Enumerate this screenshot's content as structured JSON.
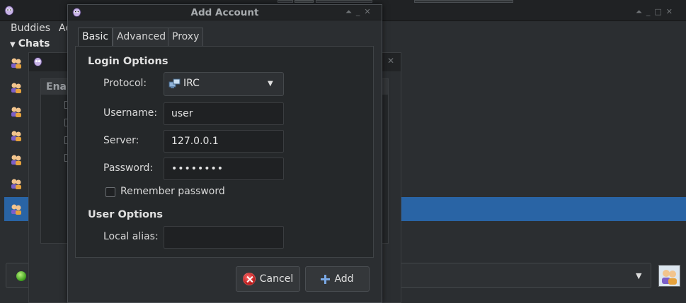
{
  "buddy_window": {
    "menu": [
      "Buddies",
      "Ac"
    ],
    "chats_header": "Chats"
  },
  "accounts_window": {
    "column_header": "Enal"
  },
  "dialog": {
    "title": "Add Account",
    "tabs": [
      {
        "label": "Basic",
        "active": true
      },
      {
        "label": "Advanced",
        "active": false
      },
      {
        "label": "Proxy",
        "active": false
      }
    ],
    "login_options": {
      "title": "Login Options",
      "protocol_label": "Protocol:",
      "protocol_value": "IRC",
      "username_label": "Username:",
      "username_value": "user",
      "server_label": "Server:",
      "server_value": "127.0.0.1",
      "password_label": "Password:",
      "password_value": "••••••••",
      "remember_label": "Remember password",
      "remember_checked": false
    },
    "user_options": {
      "title": "User Options",
      "alias_label": "Local alias:",
      "alias_value": ""
    },
    "buttons": {
      "cancel": "Cancel",
      "add": "Add"
    }
  },
  "colors": {
    "selection": "#2964a5",
    "window_bg": "#2b2e31",
    "panel_bg": "#25282a"
  }
}
